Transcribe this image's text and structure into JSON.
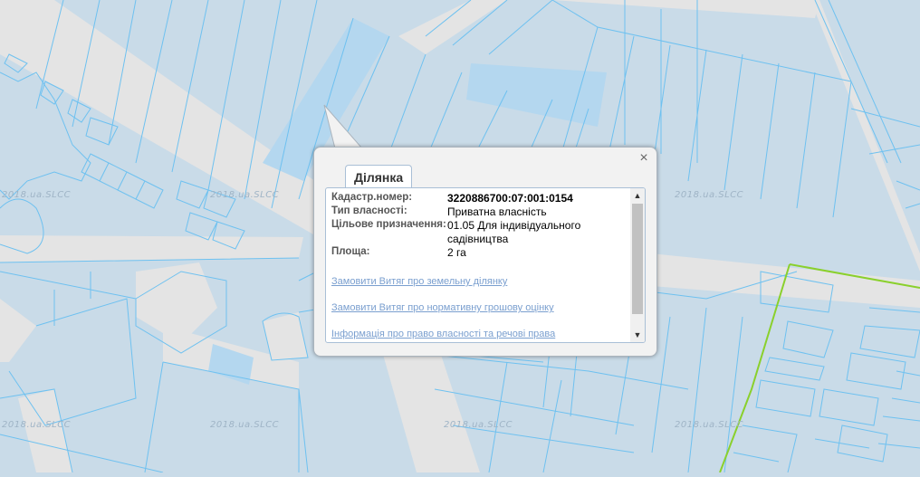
{
  "map": {
    "watermarks": [
      "2018.ua.SLCC",
      "2018.ua.SLCC",
      "2018.ua.SLCC",
      "2018.ua.SLCC",
      "2018.ua.SLCC",
      "2018.ua.SLCC"
    ],
    "colors": {
      "parcel_fill": "#c9dbe8",
      "parcel_line": "#6ec1f0",
      "road": "#e4e4e4",
      "selected_parcel": "#b4d7ef",
      "boundary": "#8ad02c"
    }
  },
  "popup": {
    "tab_label": "Ділянка",
    "close_label": "×",
    "fields": [
      {
        "key": "Кадастр.номер:",
        "value": "3220886700:07:001:0154"
      },
      {
        "key": "Тип власності:",
        "value": "Приватна власність"
      },
      {
        "key": "Цільове призначення:",
        "value": "01.05 Для індивідуального садівництва"
      },
      {
        "key": "Площа:",
        "value": "2 га"
      }
    ],
    "links": [
      "Замовити Витяг про земельну ділянку",
      "Замовити Витяг про нормативну грошову оцінку",
      "Інформація про право власності та речові права"
    ],
    "scroll_up": "▲",
    "scroll_down": "▼"
  }
}
